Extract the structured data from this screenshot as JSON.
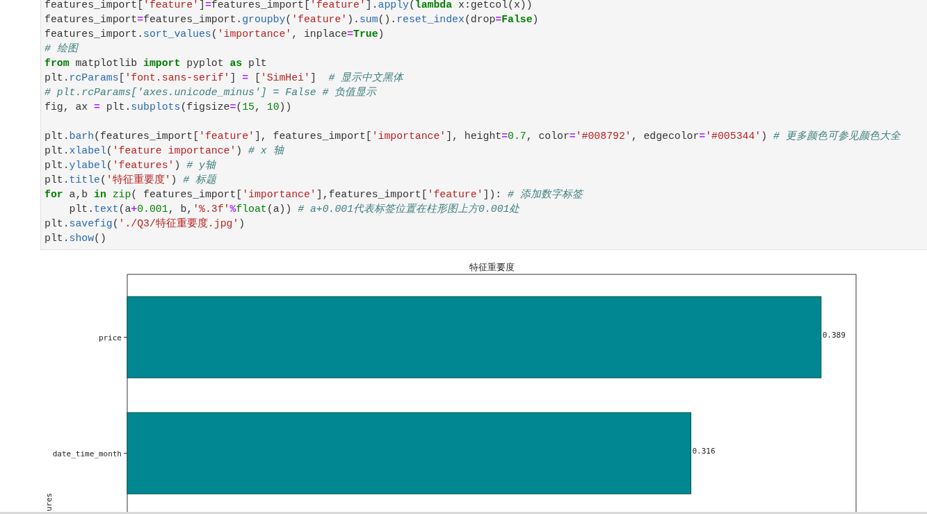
{
  "code_cell": {
    "lines": [
      {
        "kind": "code",
        "tokens": [
          {
            "kind": "text",
            "text": "features_import["
          },
          {
            "kind": "string",
            "text": "'feature'"
          },
          {
            "kind": "text",
            "text": "]"
          },
          {
            "kind": "operator",
            "text": "="
          },
          {
            "kind": "text",
            "text": "features_import["
          },
          {
            "kind": "string",
            "text": "'feature'"
          },
          {
            "kind": "text",
            "text": "]."
          },
          {
            "kind": "function",
            "text": "apply"
          },
          {
            "kind": "text",
            "text": "("
          },
          {
            "kind": "keyword",
            "text": "lambda"
          },
          {
            "kind": "text",
            "text": " x:getcol(x))"
          }
        ]
      },
      {
        "kind": "code",
        "tokens": [
          {
            "kind": "text",
            "text": "features_import"
          },
          {
            "kind": "operator",
            "text": "="
          },
          {
            "kind": "text",
            "text": "features_import."
          },
          {
            "kind": "function",
            "text": "groupby"
          },
          {
            "kind": "text",
            "text": "("
          },
          {
            "kind": "string",
            "text": "'feature'"
          },
          {
            "kind": "text",
            "text": ")."
          },
          {
            "kind": "function",
            "text": "sum"
          },
          {
            "kind": "text",
            "text": "()."
          },
          {
            "kind": "function",
            "text": "reset_index"
          },
          {
            "kind": "text",
            "text": "(drop"
          },
          {
            "kind": "operator",
            "text": "="
          },
          {
            "kind": "keyword",
            "text": "False"
          },
          {
            "kind": "text",
            "text": ")"
          }
        ]
      },
      {
        "kind": "code",
        "tokens": [
          {
            "kind": "text",
            "text": "features_import."
          },
          {
            "kind": "function",
            "text": "sort_values"
          },
          {
            "kind": "text",
            "text": "("
          },
          {
            "kind": "string",
            "text": "'importance'"
          },
          {
            "kind": "text",
            "text": ", inplace"
          },
          {
            "kind": "operator",
            "text": "="
          },
          {
            "kind": "keyword",
            "text": "True"
          },
          {
            "kind": "text",
            "text": ")"
          }
        ]
      },
      {
        "kind": "code",
        "tokens": [
          {
            "kind": "comment",
            "text": "# 绘图"
          }
        ]
      },
      {
        "kind": "code",
        "tokens": [
          {
            "kind": "keyword",
            "text": "from"
          },
          {
            "kind": "text",
            "text": " matplotlib "
          },
          {
            "kind": "keyword",
            "text": "import"
          },
          {
            "kind": "text",
            "text": " pyplot "
          },
          {
            "kind": "keyword",
            "text": "as"
          },
          {
            "kind": "text",
            "text": " plt"
          }
        ]
      },
      {
        "kind": "code",
        "tokens": [
          {
            "kind": "text",
            "text": "plt."
          },
          {
            "kind": "function",
            "text": "rcParams"
          },
          {
            "kind": "text",
            "text": "["
          },
          {
            "kind": "string",
            "text": "'font.sans-serif'"
          },
          {
            "kind": "text",
            "text": "] "
          },
          {
            "kind": "operator",
            "text": "="
          },
          {
            "kind": "text",
            "text": " ["
          },
          {
            "kind": "string",
            "text": "'SimHei'"
          },
          {
            "kind": "text",
            "text": "]  "
          },
          {
            "kind": "comment",
            "text": "# 显示中文黑体"
          }
        ]
      },
      {
        "kind": "code",
        "tokens": [
          {
            "kind": "comment",
            "text": "# plt.rcParams['axes.unicode_minus'] = False # 负值显示"
          }
        ]
      },
      {
        "kind": "code",
        "tokens": [
          {
            "kind": "text",
            "text": "fig, ax "
          },
          {
            "kind": "operator",
            "text": "="
          },
          {
            "kind": "text",
            "text": " plt."
          },
          {
            "kind": "function",
            "text": "subplots"
          },
          {
            "kind": "text",
            "text": "(figsize"
          },
          {
            "kind": "operator",
            "text": "="
          },
          {
            "kind": "text",
            "text": "("
          },
          {
            "kind": "number",
            "text": "15"
          },
          {
            "kind": "text",
            "text": ", "
          },
          {
            "kind": "number",
            "text": "10"
          },
          {
            "kind": "text",
            "text": "))"
          }
        ]
      },
      {
        "kind": "blank"
      },
      {
        "kind": "code",
        "tokens": [
          {
            "kind": "text",
            "text": "plt."
          },
          {
            "kind": "function",
            "text": "barh"
          },
          {
            "kind": "text",
            "text": "(features_import["
          },
          {
            "kind": "string",
            "text": "'feature'"
          },
          {
            "kind": "text",
            "text": "], features_import["
          },
          {
            "kind": "string",
            "text": "'importance'"
          },
          {
            "kind": "text",
            "text": "], height"
          },
          {
            "kind": "operator",
            "text": "="
          },
          {
            "kind": "number",
            "text": "0.7"
          },
          {
            "kind": "text",
            "text": ", color"
          },
          {
            "kind": "operator",
            "text": "="
          },
          {
            "kind": "string",
            "text": "'#008792'"
          },
          {
            "kind": "text",
            "text": ", edgecolor"
          },
          {
            "kind": "operator",
            "text": "="
          },
          {
            "kind": "string",
            "text": "'#005344'"
          },
          {
            "kind": "text",
            "text": ") "
          },
          {
            "kind": "comment",
            "text": "# 更多颜色可参见颜色大全"
          }
        ]
      },
      {
        "kind": "code",
        "tokens": [
          {
            "kind": "text",
            "text": "plt."
          },
          {
            "kind": "function",
            "text": "xlabel"
          },
          {
            "kind": "text",
            "text": "("
          },
          {
            "kind": "string",
            "text": "'feature importance'"
          },
          {
            "kind": "text",
            "text": ") "
          },
          {
            "kind": "comment",
            "text": "# x 轴"
          }
        ]
      },
      {
        "kind": "code",
        "tokens": [
          {
            "kind": "text",
            "text": "plt."
          },
          {
            "kind": "function",
            "text": "ylabel"
          },
          {
            "kind": "text",
            "text": "("
          },
          {
            "kind": "string",
            "text": "'features'"
          },
          {
            "kind": "text",
            "text": ") "
          },
          {
            "kind": "comment",
            "text": "# y轴"
          }
        ]
      },
      {
        "kind": "code",
        "tokens": [
          {
            "kind": "text",
            "text": "plt."
          },
          {
            "kind": "function",
            "text": "title"
          },
          {
            "kind": "text",
            "text": "("
          },
          {
            "kind": "string",
            "text": "'特征重要度'"
          },
          {
            "kind": "text",
            "text": ") "
          },
          {
            "kind": "comment",
            "text": "# 标题"
          }
        ]
      },
      {
        "kind": "code",
        "tokens": [
          {
            "kind": "keyword",
            "text": "for"
          },
          {
            "kind": "text",
            "text": " a,b "
          },
          {
            "kind": "keyword",
            "text": "in"
          },
          {
            "kind": "builtin",
            "text": " zip"
          },
          {
            "kind": "text",
            "text": "( features_import["
          },
          {
            "kind": "string",
            "text": "'importance'"
          },
          {
            "kind": "text",
            "text": "],features_import["
          },
          {
            "kind": "string",
            "text": "'feature'"
          },
          {
            "kind": "text",
            "text": "]): "
          },
          {
            "kind": "comment",
            "text": "# 添加数字标签"
          }
        ]
      },
      {
        "kind": "code",
        "tokens": [
          {
            "kind": "text",
            "text": "    plt."
          },
          {
            "kind": "function",
            "text": "text"
          },
          {
            "kind": "text",
            "text": "(a"
          },
          {
            "kind": "operator",
            "text": "+"
          },
          {
            "kind": "number",
            "text": "0.001"
          },
          {
            "kind": "text",
            "text": ", b,"
          },
          {
            "kind": "string",
            "text": "'%.3f'"
          },
          {
            "kind": "operator",
            "text": "%"
          },
          {
            "kind": "builtin",
            "text": "float"
          },
          {
            "kind": "text",
            "text": "(a)) "
          },
          {
            "kind": "comment",
            "text": "# a+0.001代表标签位置在柱形图上方0.001处"
          }
        ]
      },
      {
        "kind": "code",
        "tokens": [
          {
            "kind": "text",
            "text": "plt."
          },
          {
            "kind": "function",
            "text": "savefig"
          },
          {
            "kind": "text",
            "text": "("
          },
          {
            "kind": "string",
            "text": "'./Q3/特征重要度.jpg'"
          },
          {
            "kind": "text",
            "text": ")"
          }
        ]
      },
      {
        "kind": "code",
        "tokens": [
          {
            "kind": "text",
            "text": "plt."
          },
          {
            "kind": "function",
            "text": "show"
          },
          {
            "kind": "text",
            "text": "()"
          }
        ]
      }
    ]
  },
  "output": {
    "chart_data": {
      "type": "bar",
      "orientation": "horizontal",
      "title": "特征重要度",
      "ylabel": "ures",
      "categories": [
        "price",
        "date_time_month"
      ],
      "series": [
        {
          "color": "#008792",
          "values": [
            0.389,
            0.316
          ]
        }
      ],
      "xlim": [
        0,
        0.4086
      ],
      "data_labels": true
    }
  }
}
